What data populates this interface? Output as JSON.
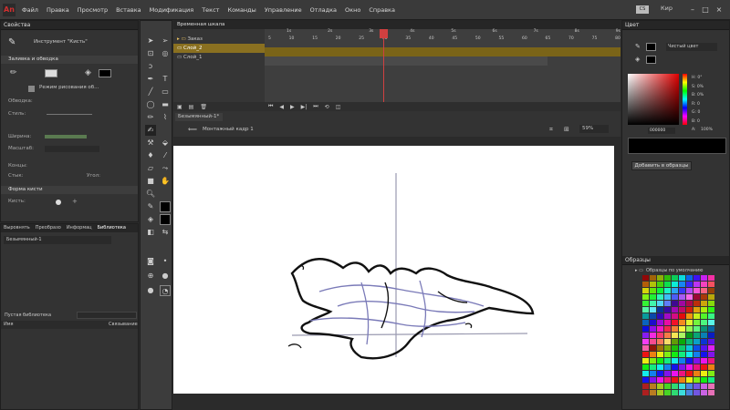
{
  "app": {
    "logo": "An"
  },
  "menu": [
    "Файл",
    "Правка",
    "Просмотр",
    "Вставка",
    "Модификация",
    "Текст",
    "Команды",
    "Управление",
    "Отладка",
    "Окно",
    "Справка"
  ],
  "user": {
    "badge": "CS",
    "name": "Кир"
  },
  "left_panel": {
    "tab": "Свойства",
    "tool_name": "Инструмент \"Кисть\"",
    "section_fill": "Заливка и обводка",
    "draw_mode": "Режим рисования об...",
    "stroke_label": "Обводка:",
    "style_label": "Стиль:",
    "width_label": "Ширина:",
    "scale_label": "Масштаб:",
    "cap_label": "Концы:",
    "join_label": "Стык:",
    "angle_label": "Угол:",
    "section_brush": "Форма кисти",
    "brush_label": "Кисть:"
  },
  "library_panel": {
    "tabs": [
      "Выровнять",
      "Преобразо",
      "Информац",
      "Библиотека"
    ],
    "doc": "Безымянный-1",
    "empty": "Пустая библиотека",
    "col_name": "Имя",
    "col_link": "Связывание"
  },
  "timeline": {
    "tab": "Временная шкала",
    "layers": [
      {
        "name": "Заказ"
      },
      {
        "name": "Слой_2"
      },
      {
        "name": "Слой_1"
      }
    ],
    "frames": [
      "5",
      "10",
      "15",
      "20",
      "25",
      "30",
      "35",
      "40",
      "45",
      "50",
      "55",
      "60",
      "65",
      "70",
      "75",
      "80"
    ],
    "fps_marks": [
      "1s",
      "2s",
      "3s",
      "4s",
      "5s",
      "6s",
      "7s",
      "8s",
      "9s"
    ]
  },
  "stage": {
    "doc_tab": "Безымянный-1*",
    "scene": "Монтажный кадр 1",
    "zoom": "59%"
  },
  "color_panel": {
    "tab": "Цвет",
    "type": "Чистый цвет",
    "labels": [
      "Н:",
      "S:",
      "В:",
      "R:",
      "G:",
      "B:"
    ],
    "values": [
      "0°",
      "0%",
      "0%",
      "0",
      "0",
      "0"
    ],
    "hex": "000000",
    "alpha_label": "A:",
    "alpha": "100%",
    "add_button": "Добавить в образцы"
  },
  "swatches_panel": {
    "tab": "Образцы",
    "name": "Образцы по умолчанию"
  }
}
